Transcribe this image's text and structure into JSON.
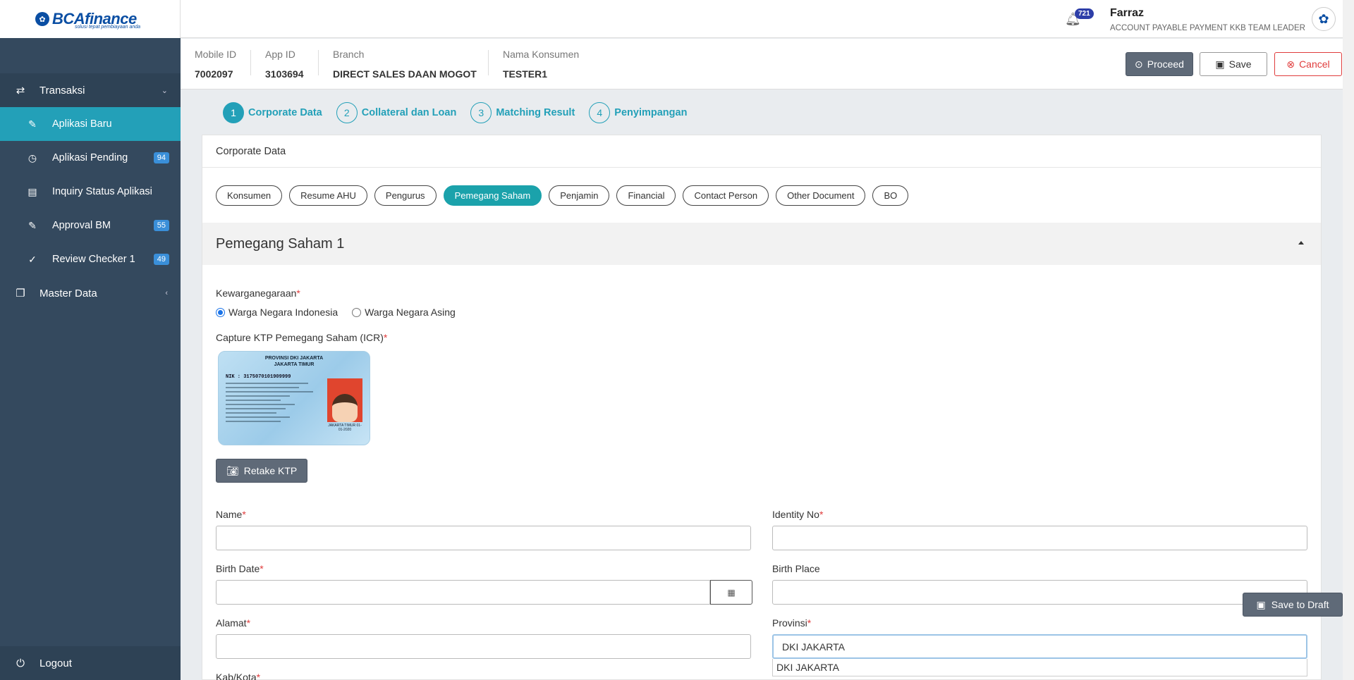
{
  "brand": {
    "logo_text": "BCAfinance",
    "logo_sub": "solusi tepat pembiayaan anda"
  },
  "sidebar": {
    "transaksi": "Transaksi",
    "items": [
      {
        "label": "Aplikasi Baru",
        "badge": ""
      },
      {
        "label": "Aplikasi Pending",
        "badge": "94"
      },
      {
        "label": "Inquiry Status Aplikasi",
        "badge": ""
      },
      {
        "label": "Approval BM",
        "badge": "55"
      },
      {
        "label": "Review Checker 1",
        "badge": "49"
      }
    ],
    "master_data": "Master Data",
    "logout": "Logout"
  },
  "topbar": {
    "notif_count": "721",
    "user_name": "Farraz",
    "user_role": "ACCOUNT PAYABLE PAYMENT KKB TEAM LEADER"
  },
  "info": {
    "mobile_id_label": "Mobile ID",
    "mobile_id": "7002097",
    "app_id_label": "App ID",
    "app_id": "3103694",
    "branch_label": "Branch",
    "branch": "DIRECT SALES DAAN MOGOT",
    "nama_label": "Nama Konsumen",
    "nama": "TESTER1"
  },
  "actions": {
    "proceed": "Proceed",
    "save": "Save",
    "cancel": "Cancel"
  },
  "steps": [
    {
      "num": "1",
      "label": "Corporate Data"
    },
    {
      "num": "2",
      "label": "Collateral dan Loan"
    },
    {
      "num": "3",
      "label": "Matching Result"
    },
    {
      "num": "4",
      "label": "Penyimpangan"
    }
  ],
  "card_title": "Corporate Data",
  "tabs": [
    "Konsumen",
    "Resume AHU",
    "Pengurus",
    "Pemegang Saham",
    "Penjamin",
    "Financial",
    "Contact Person",
    "Other Document",
    "BO"
  ],
  "section_title": "Pemegang Saham 1",
  "form": {
    "kewarganegaraan_label": "Kewarganegaraan",
    "radio_wni": "Warga Negara Indonesia",
    "radio_wna": "Warga Negara Asing",
    "capture_label": "Capture KTP Pemegang Saham (ICR)",
    "ktp": {
      "title1": "PROVINSI DKI JAKARTA",
      "title2": "JAKARTA TIMUR",
      "nik": "NIK   :  3175070101909999",
      "photo_caption": "JAKARTA TIMUR 01-01-2020"
    },
    "retake": "Retake KTP",
    "name_label": "Name",
    "identity_label": "Identity No",
    "birth_date_label": "Birth Date",
    "birth_place_label": "Birth Place",
    "alamat_label": "Alamat",
    "provinsi_label": "Provinsi",
    "provinsi_value": "DKI JAKARTA",
    "provinsi_option": "DKI JAKARTA",
    "kab_label": "Kab/Kota"
  },
  "save_draft": "Save to Draft"
}
